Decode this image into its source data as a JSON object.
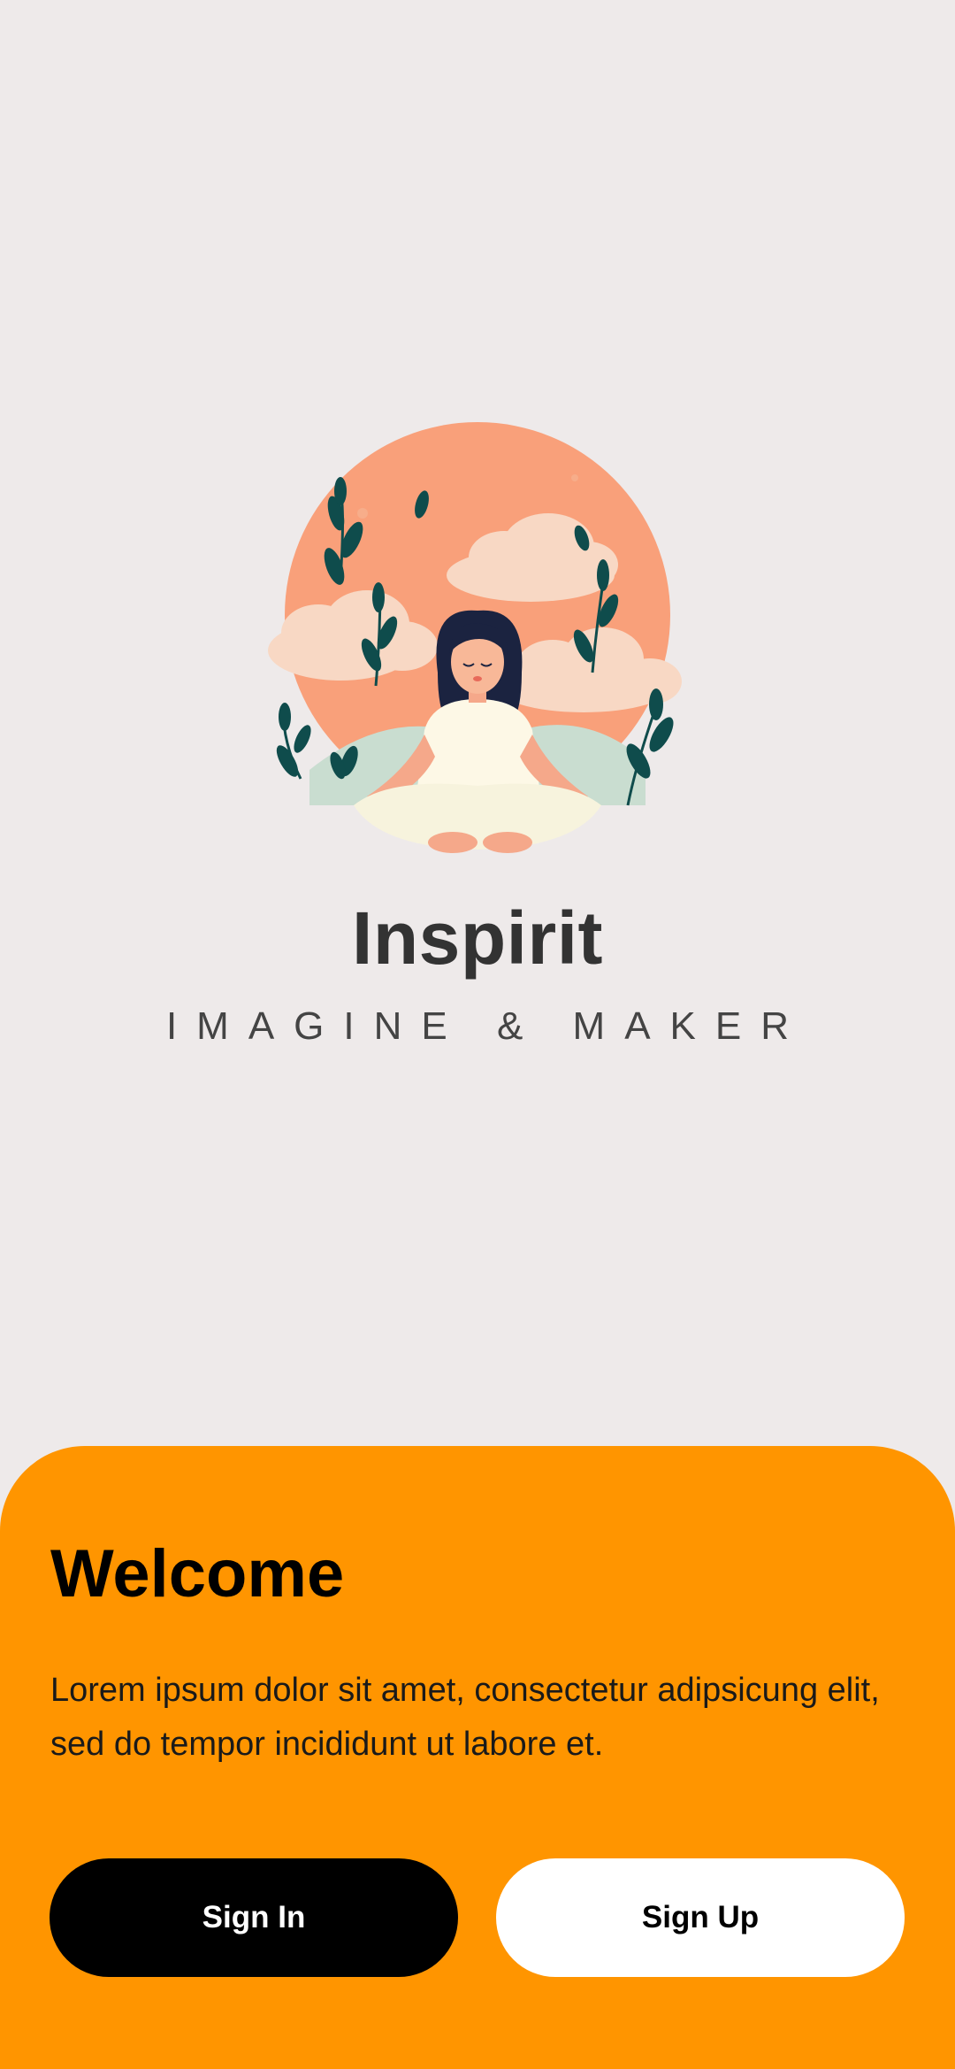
{
  "app": {
    "name": "Inspirit",
    "tagline": "IMAGINE & MAKER",
    "logo_icon": "meditation-illustration"
  },
  "welcome": {
    "title": "Welcome",
    "body": "Lorem ipsum dolor sit amet, consectetur adipsicung elit, sed do tempor incididunt ut labore et."
  },
  "actions": {
    "sign_in_label": "Sign In",
    "sign_up_label": "Sign Up"
  },
  "colors": {
    "background": "#eeeaea",
    "accent": "#ff9500",
    "primary_button": "#000000",
    "secondary_button": "#ffffff",
    "sun": "#f9a07a",
    "leaf": "#0f4c4c"
  }
}
